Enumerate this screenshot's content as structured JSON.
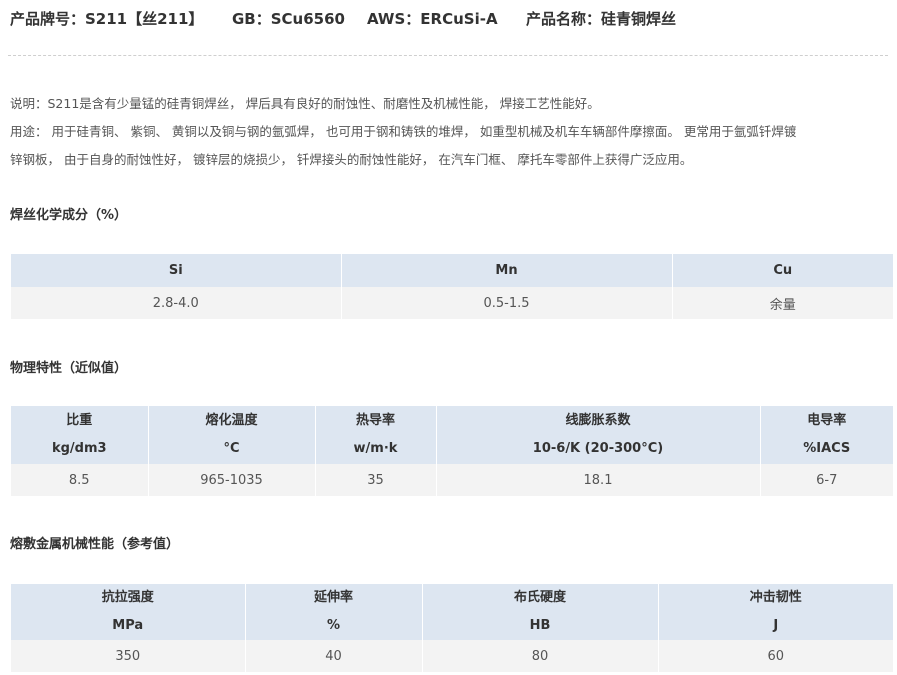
{
  "header": {
    "brand": "产品牌号：S211【丝211】",
    "gb": "GB：SCu6560",
    "aws": "AWS：ERCuSi-A",
    "product_name": "产品名称：硅青铜焊丝"
  },
  "description": {
    "line1": "说明：S211是含有少量锰的硅青铜焊丝， 焊后具有良好的耐蚀性、耐磨性及机械性能， 焊接工艺性能好。",
    "line2": "用途： 用于硅青铜、 紫铜、 黄铜以及铜与钢的氩弧焊， 也可用于钢和铸铁的堆焊， 如重型机械及机车车辆部件摩擦面。 更常用于氩弧钎焊镀",
    "line3": "锌钢板， 由于自身的耐蚀性好， 镀锌层的烧损少， 钎焊接头的耐蚀性能好， 在汽车门框、 摩托车零部件上获得广泛应用。"
  },
  "chem": {
    "title": "焊丝化学成分（%）",
    "headers": [
      "Si",
      "Mn",
      "Cu"
    ],
    "values": [
      "2.8-4.0",
      "0.5-1.5",
      "余量"
    ]
  },
  "physical": {
    "title": "物理特性（近似值）",
    "headers": [
      {
        "name": "比重",
        "unit": "kg/dm3"
      },
      {
        "name": "熔化温度",
        "unit": "°C"
      },
      {
        "name": "热导率",
        "unit": "w/m·k"
      },
      {
        "name": "线膨胀系数",
        "unit": "10-6/K (20-300°C)"
      },
      {
        "name": "电导率",
        "unit": "%IACS"
      }
    ],
    "values": [
      "8.5",
      "965-1035",
      "35",
      "18.1",
      "6-7"
    ]
  },
  "mechanical": {
    "title": "熔敷金属机械性能（参考值）",
    "headers": [
      {
        "name": "抗拉强度",
        "unit": "MPa"
      },
      {
        "name": "延伸率",
        "unit": "%"
      },
      {
        "name": "布氏硬度",
        "unit": "HB"
      },
      {
        "name": "冲击韧性",
        "unit": "J"
      }
    ],
    "values": [
      "350",
      "40",
      "80",
      "60"
    ]
  }
}
